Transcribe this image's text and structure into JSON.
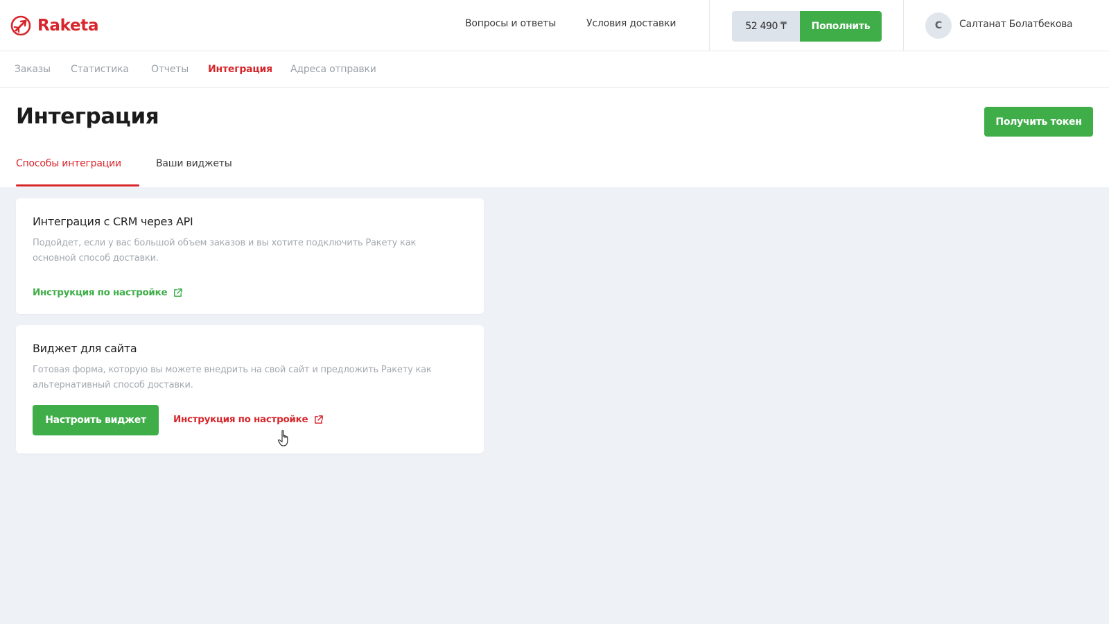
{
  "brand": {
    "name": "Raketa",
    "accent": "#d7262b",
    "green": "#3fae49"
  },
  "header": {
    "nav": [
      "Вопросы и ответы",
      "Условия доставки"
    ],
    "balance": "52 490 ₸",
    "topup_label": "Пополнить",
    "avatar_initial": "С",
    "user_name": "Салтанат Болатбекова"
  },
  "subnav": {
    "items": [
      "Заказы",
      "Статистика",
      "Отчеты",
      "Интеграция",
      "Адреса отправки"
    ],
    "active": "Интеграция"
  },
  "page": {
    "title": "Интеграция",
    "token_button": "Получить токен"
  },
  "tabs": [
    "Способы интеграции",
    "Ваши виджеты"
  ],
  "cards": [
    {
      "title": "Интеграция с CRM через API",
      "description": "Подойдет, если у вас большой объем заказов и вы хотите подключить Ракету как основной способ доставки.",
      "link": "Инструкция по настройке",
      "link_icon": "external-link-icon"
    },
    {
      "title": "Виджет для сайта",
      "description": "Готовая форма, которую вы можете внедрить на свой сайт и предложить Ракету как альтернативный способ доставки.",
      "button": "Настроить виджет",
      "link": "Инструкция по настройке",
      "link_icon": "external-link-icon"
    }
  ]
}
